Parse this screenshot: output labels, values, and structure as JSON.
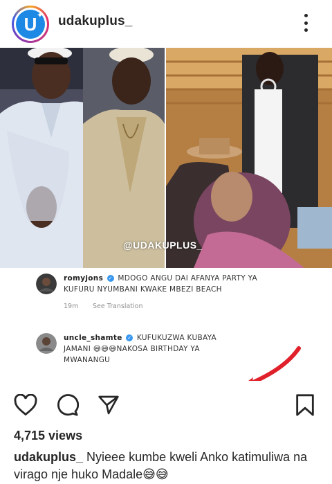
{
  "header": {
    "username": "udakuplus_",
    "avatar_letter": "U"
  },
  "post": {
    "watermark": "@UDAKUPLUS_",
    "comments": [
      {
        "user": "romyjons",
        "text_line1": "MDOGO ANGU DAI AFANYA PARTY YA",
        "text_line2": "KUFURU NYUMBANI KWAKE MBEZI BEACH",
        "time": "19m",
        "see_translation": "See Translation"
      },
      {
        "user": "uncle_shamte",
        "text_line1": "KUFUKUZWA KUBAYA",
        "text_line2": "JAMANI 😅😅😅NAKOSA BIRTHDAY YA",
        "text_line3": "MWANANGU"
      }
    ]
  },
  "actions": {
    "like_icon": "heart-icon",
    "comment_icon": "comment-icon",
    "share_icon": "send-icon",
    "save_icon": "bookmark-icon"
  },
  "views": "4,715 views",
  "caption": {
    "user": "udakuplus_",
    "text": "Nyieee kumbe kweli Anko katimuliwa na virago nje huko Madale😅😅"
  },
  "colors": {
    "accent_blue": "#3897f0",
    "arrow_red": "#e0202a",
    "text_dark": "#262626"
  }
}
